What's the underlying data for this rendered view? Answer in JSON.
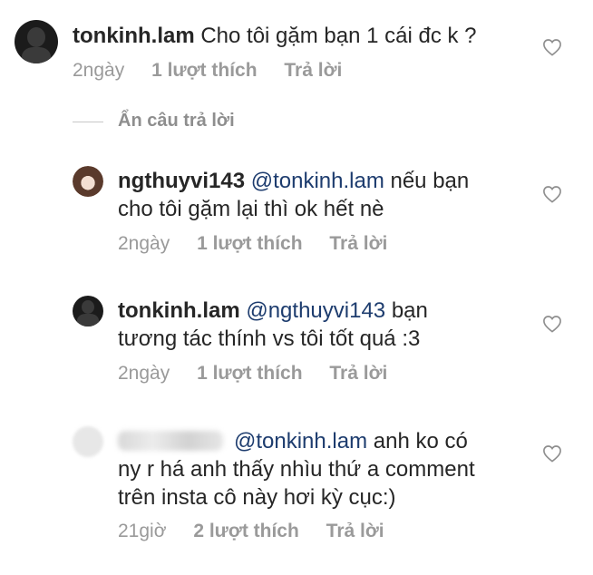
{
  "comments": [
    {
      "username": "tonkinh.lam",
      "mention": "",
      "text": "Cho tôi gặm bạn 1 cái đc k ?",
      "time": "2ngày",
      "likes": "1 lượt thích",
      "reply_label": "Trả lời"
    }
  ],
  "hide_replies_label": "Ẩn câu trả lời",
  "replies": [
    {
      "username": "ngthuyvi143",
      "mention": "@tonkinh.lam",
      "text_line1": "nếu bạn",
      "text_line2": "cho tôi gặm lại thì ok hết nè",
      "time": "2ngày",
      "likes": "1 lượt thích",
      "reply_label": "Trả lời"
    },
    {
      "username": "tonkinh.lam",
      "mention": "@ngthuyvi143",
      "text_line1": "bạn",
      "text_line2": "tương tác thính vs tôi tốt quá :3",
      "time": "2ngày",
      "likes": "1 lượt thích",
      "reply_label": "Trả lời"
    },
    {
      "username": "",
      "mention": "@tonkinh.lam",
      "text_line1": "anh ko có",
      "text_line2": "ny r há anh thấy nhìu thứ a comment",
      "text_line3": "trên insta cô này hơi kỳ cục:)",
      "time": "21giờ",
      "likes": "2 lượt thích",
      "reply_label": "Trả lời"
    }
  ],
  "icons": {
    "like": "heart-outline-icon"
  },
  "colors": {
    "text": "#262626",
    "meta": "#9a9a9a",
    "mention": "#1d3c6e"
  }
}
